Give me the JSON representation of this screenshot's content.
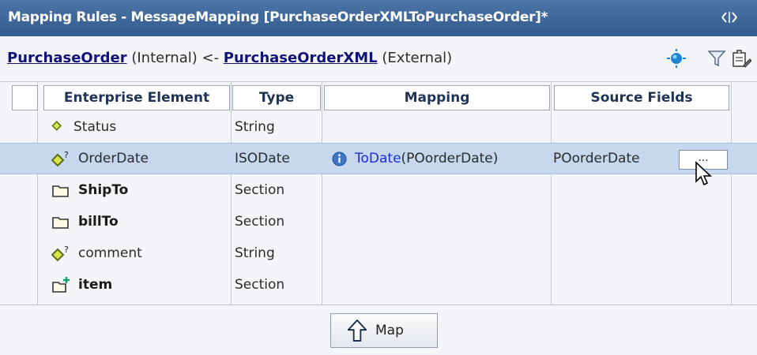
{
  "window": {
    "title": "Mapping Rules - MessageMapping [PurchaseOrderXMLToPurchaseOrder]*"
  },
  "subheader": {
    "target": "PurchaseOrder",
    "target_kind": "(Internal)",
    "arrow": "<-",
    "source": "PurchaseOrderXML",
    "source_kind": "(External)"
  },
  "grid": {
    "columns": [
      "Enterprise Element",
      "Type",
      "Mapping",
      "Source Fields"
    ],
    "rows": [
      {
        "name": "Status",
        "type": "String",
        "mapping_func": "",
        "mapping_args": "",
        "source": "",
        "icon": "diamond-icon",
        "bold": false
      },
      {
        "name": "OrderDate",
        "type": "ISODate",
        "mapping_func": "ToDate",
        "mapping_args": "(POorderDate)",
        "source": "POorderDate",
        "icon": "optional-diamond-icon",
        "bold": false,
        "selected": true,
        "browse_label": "..."
      },
      {
        "name": "ShipTo",
        "type": "Section",
        "mapping_func": "",
        "mapping_args": "",
        "source": "",
        "icon": "folder-icon",
        "bold": true
      },
      {
        "name": "billTo",
        "type": "Section",
        "mapping_func": "",
        "mapping_args": "",
        "source": "",
        "icon": "folder-icon",
        "bold": true
      },
      {
        "name": "comment",
        "type": "String",
        "mapping_func": "",
        "mapping_args": "",
        "source": "",
        "icon": "optional-diamond-icon",
        "bold": false
      },
      {
        "name": "item",
        "type": "Section",
        "mapping_func": "",
        "mapping_args": "",
        "source": "",
        "icon": "repeating-folder-icon",
        "bold": true
      }
    ]
  },
  "footer": {
    "map_label": "Map"
  },
  "colors": {
    "titlebar": "#3f6699",
    "selected_row": "#c7d7ee",
    "link": "#10137a",
    "func_link": "#1b2fd8"
  }
}
